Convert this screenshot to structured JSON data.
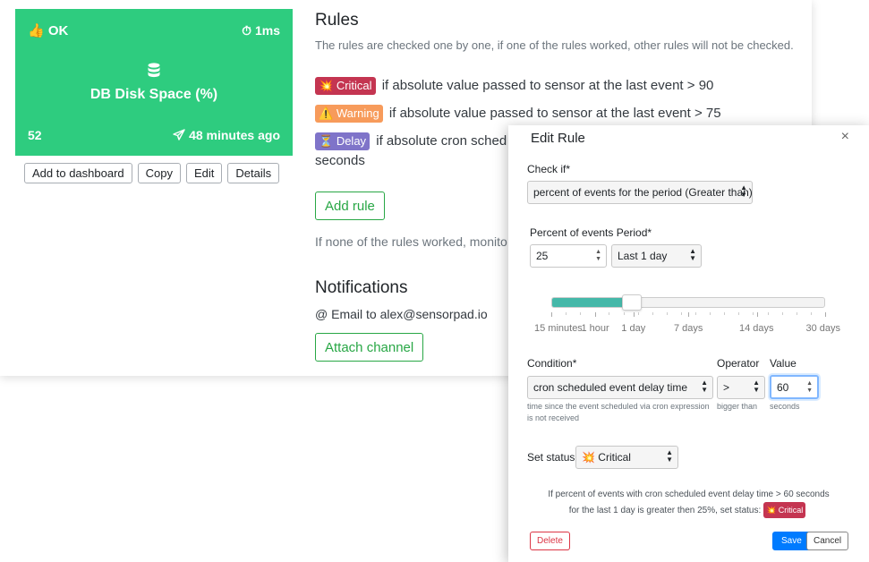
{
  "sensor": {
    "status_icon": "thumbs-up-icon",
    "status": "OK",
    "timing": "1ms",
    "title": "DB Disk Space (%)",
    "count": "52",
    "last_event": "48 minutes ago",
    "color": "#2ecc7f",
    "actions": [
      "Add to dashboard",
      "Copy",
      "Edit",
      "Details"
    ]
  },
  "rules": {
    "heading": "Rules",
    "description": "The rules are checked one by one, if one of the rules worked, other rules will not be checked.",
    "items": [
      {
        "badge": "Critical",
        "emoji": "💥",
        "text": "if absolute value passed to sensor at the last event > 90"
      },
      {
        "badge": "Warning",
        "emoji": "⚠️",
        "text": "if absolute value passed to sensor at the last event > 75"
      },
      {
        "badge": "Delay",
        "emoji": "⏳",
        "text": "if absolute cron sched",
        "text_cont": "seconds"
      }
    ],
    "add_rule": "Add rule",
    "fallback": "If none of the rules worked, monito"
  },
  "notifications": {
    "heading": "Notifications",
    "email": "@ Email to alex@sensorpad.io",
    "attach": "Attach channel"
  },
  "modal": {
    "title": "Edit Rule",
    "check_if_label": "Check if*",
    "check_if_value": "percent of events for the period (Greater than)",
    "period_label": "Percent of events Period*",
    "percent_value": "25",
    "period_value": "Last 1 day",
    "slider_fraction": 0.29,
    "slider_ticks": [
      "15 minutes",
      "1 hour",
      "1 day",
      "7 days",
      "14 days",
      "30 days"
    ],
    "condition_label": "Condition*",
    "condition_value": "cron scheduled event delay time",
    "condition_hint": "time since the event scheduled via cron expression is not received",
    "operator_label": "Operator",
    "operator_value": ">",
    "operator_hint": "bigger than",
    "value_label": "Value",
    "value_value": "60",
    "value_hint": "seconds",
    "status_label": "Set status",
    "status_value": "Critical",
    "status_emoji": "💥",
    "summary_line1": "If percent of events with cron scheduled event delay time > 60 seconds",
    "summary_line2": "for the last 1 day is greater then 25%, set status:",
    "summary_badge": "Critical",
    "delete": "Delete",
    "save": "Save",
    "cancel": "Cancel"
  }
}
